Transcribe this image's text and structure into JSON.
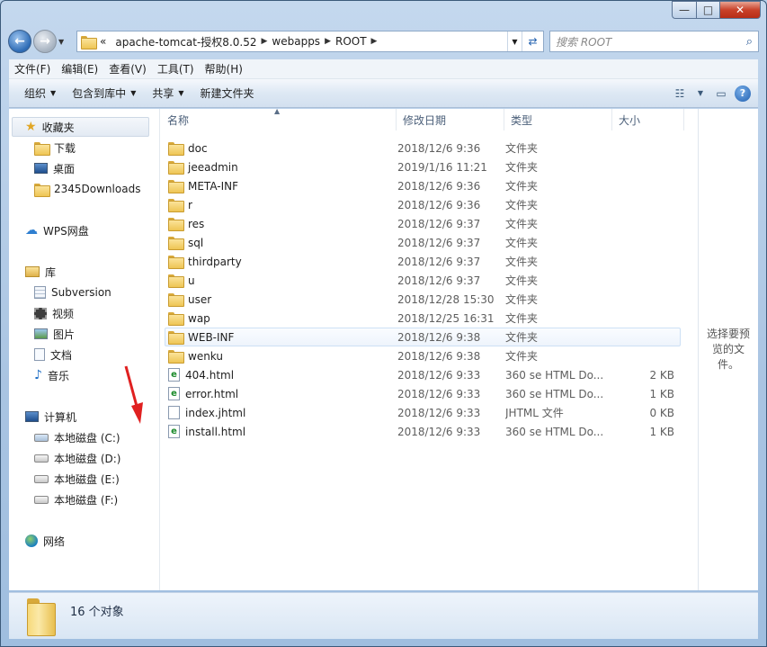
{
  "window": {
    "caption_buttons": {
      "minimize": "—",
      "maximize": "□",
      "close": "✕"
    }
  },
  "address": {
    "overflow": "«",
    "crumbs": [
      "apache-tomcat-授权8.0.52",
      "webapps",
      "ROOT"
    ],
    "refresh_icon": "refresh-icon"
  },
  "search": {
    "placeholder": "搜索 ROOT"
  },
  "menu": [
    "文件(F)",
    "编辑(E)",
    "查看(V)",
    "工具(T)",
    "帮助(H)"
  ],
  "toolbar": {
    "organize": "组织",
    "include_library": "包含到库中",
    "share": "共享",
    "new_folder": "新建文件夹"
  },
  "navpane": {
    "favorites": "收藏夹",
    "downloads": "下载",
    "desktop": "桌面",
    "downloads2345": "2345Downloads",
    "wps": "WPS网盘",
    "libraries": "库",
    "subversion": "Subversion",
    "videos": "视频",
    "pictures": "图片",
    "documents": "文档",
    "music": "音乐",
    "computer": "计算机",
    "drive_c": "本地磁盘 (C:)",
    "drive_d": "本地磁盘 (D:)",
    "drive_e": "本地磁盘 (E:)",
    "drive_f": "本地磁盘 (F:)",
    "network": "网络"
  },
  "columns": {
    "name": "名称",
    "date": "修改日期",
    "type": "类型",
    "size": "大小"
  },
  "files": [
    {
      "name": "doc",
      "date": "2018/12/6 9:36",
      "type": "文件夹",
      "size": "",
      "kind": "folder"
    },
    {
      "name": "jeeadmin",
      "date": "2019/1/16 11:21",
      "type": "文件夹",
      "size": "",
      "kind": "folder"
    },
    {
      "name": "META-INF",
      "date": "2018/12/6 9:36",
      "type": "文件夹",
      "size": "",
      "kind": "folder"
    },
    {
      "name": "r",
      "date": "2018/12/6 9:36",
      "type": "文件夹",
      "size": "",
      "kind": "folder"
    },
    {
      "name": "res",
      "date": "2018/12/6 9:37",
      "type": "文件夹",
      "size": "",
      "kind": "folder"
    },
    {
      "name": "sql",
      "date": "2018/12/6 9:37",
      "type": "文件夹",
      "size": "",
      "kind": "folder"
    },
    {
      "name": "thirdparty",
      "date": "2018/12/6 9:37",
      "type": "文件夹",
      "size": "",
      "kind": "folder"
    },
    {
      "name": "u",
      "date": "2018/12/6 9:37",
      "type": "文件夹",
      "size": "",
      "kind": "folder"
    },
    {
      "name": "user",
      "date": "2018/12/28 15:30",
      "type": "文件夹",
      "size": "",
      "kind": "folder"
    },
    {
      "name": "wap",
      "date": "2018/12/25 16:31",
      "type": "文件夹",
      "size": "",
      "kind": "folder"
    },
    {
      "name": "WEB-INF",
      "date": "2018/12/6 9:38",
      "type": "文件夹",
      "size": "",
      "kind": "folder",
      "selected": true
    },
    {
      "name": "wenku",
      "date": "2018/12/6 9:38",
      "type": "文件夹",
      "size": "",
      "kind": "folder"
    },
    {
      "name": "404.html",
      "date": "2018/12/6 9:33",
      "type": "360 se HTML Do...",
      "size": "2 KB",
      "kind": "html"
    },
    {
      "name": "error.html",
      "date": "2018/12/6 9:33",
      "type": "360 se HTML Do...",
      "size": "1 KB",
      "kind": "html"
    },
    {
      "name": "index.jhtml",
      "date": "2018/12/6 9:33",
      "type": "JHTML 文件",
      "size": "0 KB",
      "kind": "blank"
    },
    {
      "name": "install.html",
      "date": "2018/12/6 9:33",
      "type": "360 se HTML Do...",
      "size": "1 KB",
      "kind": "html"
    }
  ],
  "preview": {
    "text": "选择要预览的文件。"
  },
  "status": {
    "count": "16 个对象"
  },
  "colors": {
    "annotation_arrow": "#e02020",
    "selection_border": "#cde0f5"
  }
}
